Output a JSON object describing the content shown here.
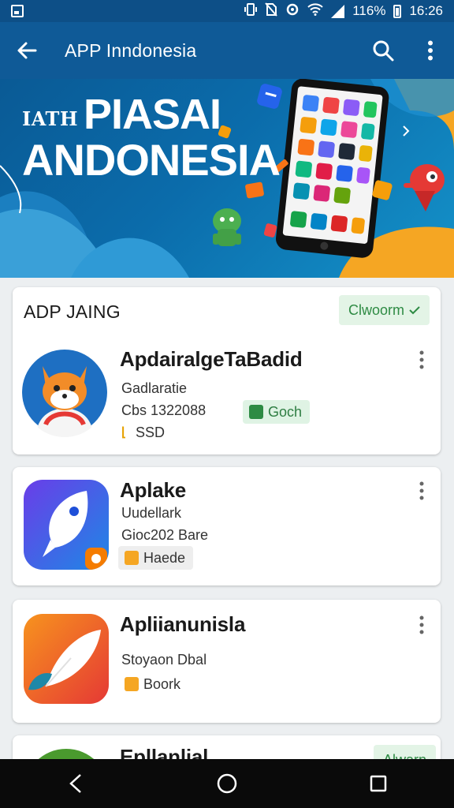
{
  "status_bar": {
    "battery": "116%",
    "time": "16:26"
  },
  "app_bar": {
    "title": "APP Inndonesia"
  },
  "banner": {
    "small_text": "IATH",
    "line1": "PIASAI",
    "line2": "ANDONESIA"
  },
  "section": {
    "header": "ADP JAING",
    "badge": "Clwoorm"
  },
  "apps": [
    {
      "name": "ApdairalgeTaBadid",
      "line1": "Gadlaratie",
      "line2": "Cbs 1322088",
      "line3": "SSD",
      "tag": "Goch"
    },
    {
      "name": "Aplake",
      "line1": "Uudellark",
      "line2": "Gioc202 Bare",
      "tag": "Haede"
    },
    {
      "name": "Apliianunisla",
      "line1": "Stoyaon Dbal",
      "tag": "Boork"
    },
    {
      "name": "Epllanlial",
      "badge": "Alwarn"
    }
  ],
  "colors": {
    "app_bar": "#0f5a97",
    "status_bar": "#0d4f87",
    "accent_green": "#2e8b44",
    "tag_orange": "#f5a623"
  },
  "icons": [
    "back-arrow-icon",
    "search-icon",
    "more-vert-icon",
    "nav-back-icon",
    "nav-home-icon",
    "nav-recents-icon"
  ]
}
